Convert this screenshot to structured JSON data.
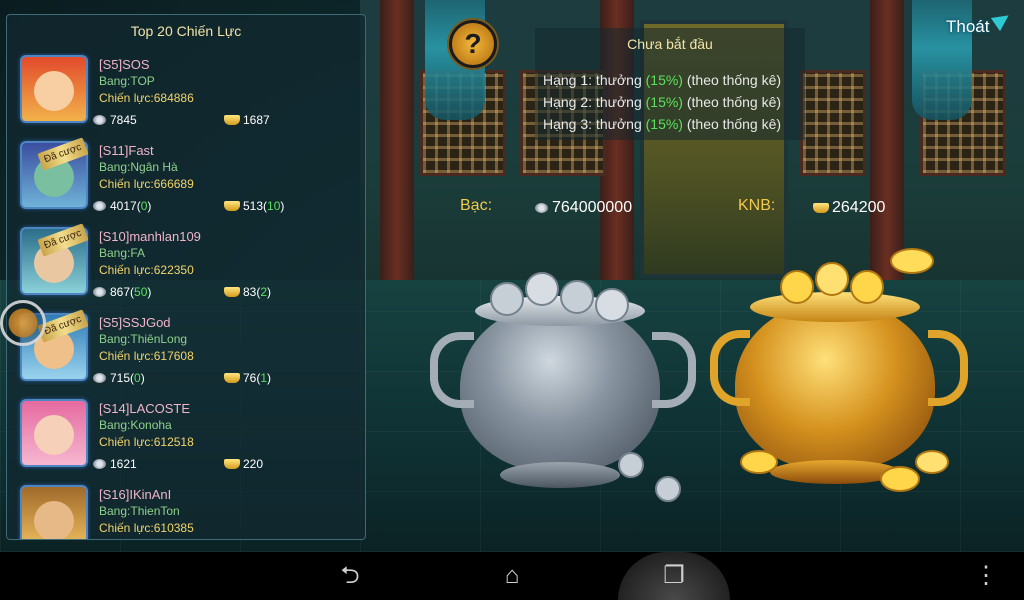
{
  "panel": {
    "title": "Top 20 Chiến Lực",
    "rows": [
      {
        "name": "[S5]SOS",
        "guild": "Bang:TOP",
        "power": "Chiến lực:684886",
        "silver": "7845",
        "silver_extra": "",
        "gold": "1687",
        "gold_extra": "",
        "badge": ""
      },
      {
        "name": "[S11]Fast",
        "guild": "Bang:Ngân Hà",
        "power": "Chiến lực:666689",
        "silver": "4017",
        "silver_extra": "0",
        "gold": "513",
        "gold_extra": "10",
        "badge": "Đã cược"
      },
      {
        "name": "[S10]manhlan109",
        "guild": "Bang:FA",
        "power": "Chiến lực:622350",
        "silver": "867",
        "silver_extra": "50",
        "gold": "83",
        "gold_extra": "2",
        "badge": "Đã cược"
      },
      {
        "name": "[S5]SSJGod",
        "guild": "Bang:ThiênLong",
        "power": "Chiến lực:617608",
        "silver": "715",
        "silver_extra": "0",
        "gold": "76",
        "gold_extra": "1",
        "badge": "Đã cược"
      },
      {
        "name": "[S14]LACOSTE",
        "guild": "Bang:Konoha",
        "power": "Chiến lực:612518",
        "silver": "1621",
        "silver_extra": "",
        "gold": "220",
        "gold_extra": "",
        "badge": ""
      },
      {
        "name": "[S16]IKinAnI",
        "guild": "Bang:ThienTon",
        "power": "Chiến lực:610385",
        "silver": "",
        "silver_extra": "",
        "gold": "",
        "gold_extra": "",
        "badge": ""
      }
    ]
  },
  "status": {
    "title": "Chưa bắt đầu",
    "rewards": [
      {
        "prefix": "Hạng 1: thưởng ",
        "pct": "(15%)",
        "suffix": " (theo thống kê)"
      },
      {
        "prefix": "Hạng 2: thưởng ",
        "pct": "(15%)",
        "suffix": " (theo thống kê)"
      },
      {
        "prefix": "Hạng 3: thưởng ",
        "pct": "(15%)",
        "suffix": " (theo thống kê)"
      }
    ]
  },
  "totals": {
    "silver_label": "Bạc:",
    "silver_value": "764000000",
    "gold_label": "KNB:",
    "gold_value": "264200"
  },
  "buttons": {
    "help": "?",
    "exit": "Thoát"
  },
  "navbar": {
    "back": "⮌",
    "home": "⌂",
    "recent": "❐",
    "menu": "⋮"
  },
  "colors": {
    "name": "#f0b5c8",
    "guild": "#8fd18b",
    "power": "#f2d46b",
    "highlight_green": "#59e35a",
    "label_gold": "#f4c94a"
  },
  "icons": [
    "silver-coin-icon",
    "gold-ingot-icon",
    "help-icon",
    "exit-arrow-icon",
    "back-icon",
    "home-icon",
    "recent-apps-icon",
    "menu-icon"
  ]
}
